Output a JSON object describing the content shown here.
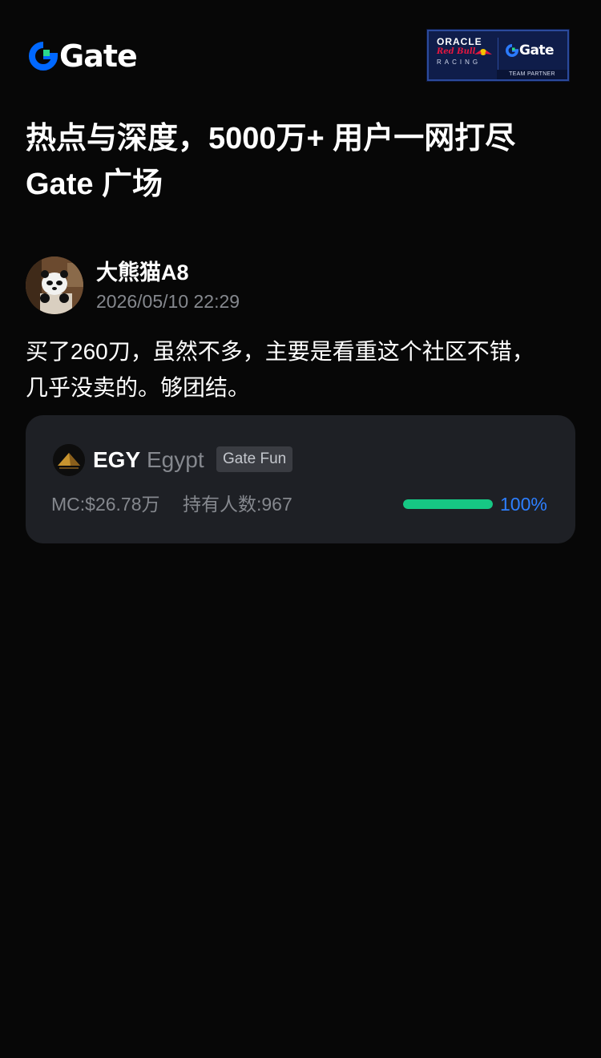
{
  "brand": {
    "name": "Gate",
    "accent": "#0068ff",
    "accent_secondary": "#2bd98c"
  },
  "partner_badge": {
    "oracle": "ORACLE",
    "redbull": "Red Bull",
    "racing": "RACING",
    "gate": "Gate",
    "team_partner": "TEAM PARTNER"
  },
  "headline": {
    "line1": "热点与深度，5000万+ 用户一网打尽",
    "line2": "Gate 广场"
  },
  "post": {
    "author": "大熊猫A8",
    "timestamp": "2026/05/10 22:29",
    "body_line1": "买了260刀，虽然不多，主要是看重这个社区不错，",
    "body_line2": "几乎没卖的。够团结。"
  },
  "token": {
    "symbol": "EGY",
    "name": "Egypt",
    "tag": "Gate Fun",
    "market_cap": "MC:$26.78万",
    "holders": "持有人数:967",
    "progress_label": "100%",
    "progress": 1.0,
    "icon": "pyramid-icon"
  },
  "colors": {
    "background": "#070707",
    "card": "#1e2025",
    "progress": "#16c784",
    "progress_text": "#2d7fff"
  }
}
